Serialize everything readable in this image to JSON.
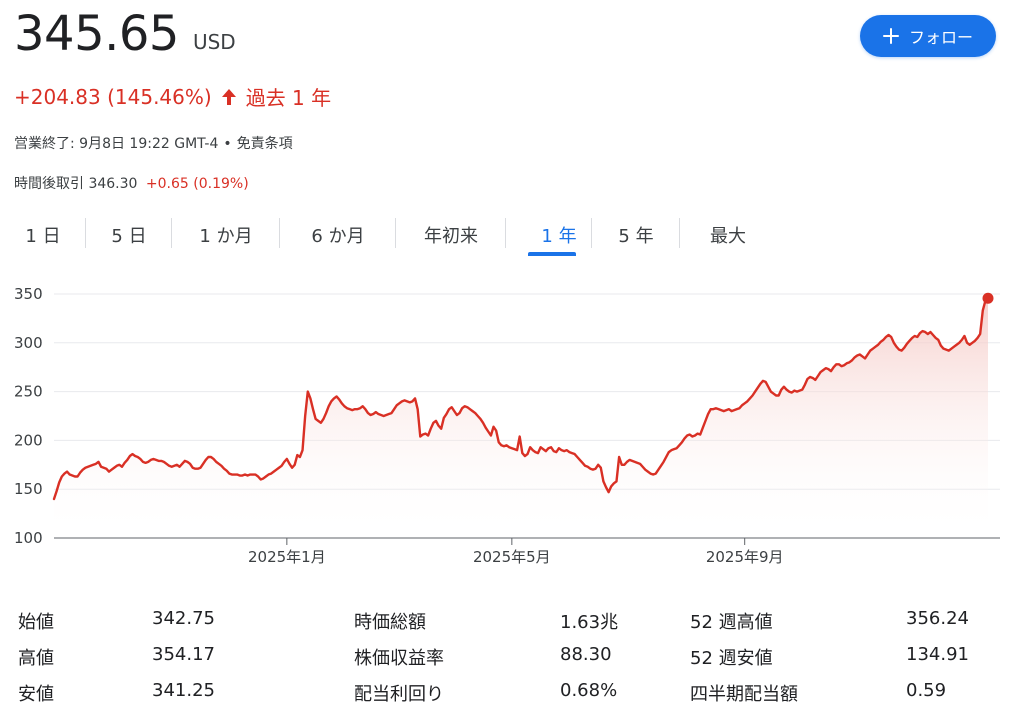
{
  "quote": {
    "price": "345.65",
    "currency": "USD",
    "change": "+204.83 (145.46%)",
    "period": "過去 1 年",
    "market_status": "営業終了: 9月8日 19:22 GMT-4",
    "separator": "•",
    "disclaimer": "免責条項",
    "after_hours_label": "時間後取引",
    "after_hours_price": "346.30",
    "after_hours_change": "+0.65 (0.19%)"
  },
  "follow_button": {
    "label": "フォロー"
  },
  "range_tabs": [
    {
      "label": "1 日",
      "active": false
    },
    {
      "label": "5 日",
      "active": false
    },
    {
      "label": "1 か月",
      "active": false
    },
    {
      "label": "6 か月",
      "active": false
    },
    {
      "label": "年初来",
      "active": false
    },
    {
      "label": "1 年",
      "active": true
    },
    {
      "label": "5 年",
      "active": false
    },
    {
      "label": "最大",
      "active": false
    }
  ],
  "colors": {
    "line": "#d93025",
    "accent": "#1a73e8",
    "grid": "#e8eaed",
    "fill_top": "#f4c7c3"
  },
  "chart_data": {
    "type": "area",
    "ylim": [
      100,
      350
    ],
    "yticks": [
      100,
      150,
      200,
      250,
      300,
      350
    ],
    "x_ticks": [
      {
        "label": "2025年1月",
        "index": 89
      },
      {
        "label": "2025年5月",
        "index": 175
      },
      {
        "label": "2025年9月",
        "index": 264
      }
    ],
    "values": [
      140,
      148,
      157,
      163,
      166,
      168,
      165,
      164,
      163,
      163,
      167,
      170,
      172,
      173,
      174,
      175,
      176,
      178,
      173,
      172,
      171,
      168,
      170,
      172,
      174,
      175,
      173,
      177,
      180,
      184,
      186,
      184,
      183,
      181,
      178,
      177,
      178,
      180,
      181,
      180,
      179,
      179,
      178,
      176,
      174,
      173,
      174,
      175,
      173,
      176,
      179,
      178,
      176,
      172,
      171,
      171,
      172,
      176,
      180,
      183,
      183,
      181,
      178,
      176,
      174,
      171,
      169,
      166,
      165,
      165,
      165,
      164,
      164,
      165,
      164,
      165,
      165,
      165,
      163,
      160,
      161,
      163,
      165,
      166,
      168,
      170,
      172,
      174,
      178,
      181,
      176,
      172,
      175,
      185,
      183,
      190,
      225,
      250,
      243,
      232,
      222,
      220,
      218,
      222,
      228,
      235,
      240,
      243,
      245,
      242,
      238,
      235,
      233,
      232,
      231,
      232,
      232,
      233,
      235,
      232,
      228,
      226,
      227,
      229,
      227,
      226,
      225,
      226,
      227,
      228,
      232,
      236,
      238,
      240,
      241,
      240,
      239,
      240,
      243,
      232,
      204,
      206,
      207,
      205,
      212,
      218,
      220,
      215,
      212,
      223,
      227,
      232,
      234,
      230,
      226,
      228,
      233,
      235,
      234,
      232,
      230,
      228,
      225,
      222,
      218,
      213,
      209,
      205,
      214,
      210,
      198,
      195,
      194,
      195,
      193,
      192,
      191,
      190,
      204,
      187,
      184,
      186,
      193,
      190,
      188,
      187,
      193,
      191,
      189,
      192,
      193,
      189,
      188,
      192,
      190,
      189,
      190,
      188,
      187,
      186,
      183,
      180,
      177,
      174,
      173,
      171,
      170,
      171,
      175,
      172,
      158,
      152,
      147,
      153,
      156,
      158,
      183,
      175,
      175,
      178,
      180,
      179,
      178,
      177,
      176,
      173,
      170,
      168,
      166,
      165,
      166,
      170,
      174,
      178,
      183,
      188,
      190,
      191,
      192,
      195,
      198,
      202,
      205,
      206,
      204,
      205,
      207,
      206,
      213,
      220,
      227,
      232,
      232,
      233,
      232,
      231,
      230,
      231,
      232,
      230,
      231,
      232,
      233,
      236,
      238,
      240,
      243,
      246,
      250,
      254,
      258,
      261,
      260,
      255,
      250,
      248,
      246,
      246,
      252,
      255,
      252,
      250,
      249,
      251,
      250,
      251,
      252,
      257,
      263,
      265,
      264,
      262,
      266,
      270,
      272,
      274,
      273,
      271,
      275,
      278,
      278,
      276,
      277,
      279,
      280,
      282,
      285,
      287,
      288,
      286,
      284,
      288,
      292,
      294,
      296,
      298,
      301,
      303,
      306,
      308,
      306,
      300,
      296,
      293,
      292,
      295,
      299,
      302,
      305,
      307,
      306,
      310,
      312,
      311,
      309,
      311,
      308,
      305,
      303,
      297,
      294,
      293,
      292,
      294,
      296,
      298,
      300,
      303,
      307,
      300,
      298,
      300,
      302,
      305,
      309,
      333,
      343,
      345.65
    ]
  },
  "stats": [
    [
      {
        "label": "始値",
        "value": "342.75"
      },
      {
        "label": "時価総額",
        "value": "1.63兆"
      },
      {
        "label": "52 週高値",
        "value": "356.24"
      }
    ],
    [
      {
        "label": "高値",
        "value": "354.17"
      },
      {
        "label": "株価収益率",
        "value": "88.30"
      },
      {
        "label": "52 週安値",
        "value": "134.91"
      }
    ],
    [
      {
        "label": "安値",
        "value": "341.25"
      },
      {
        "label": "配当利回り",
        "value": "0.68%"
      },
      {
        "label": "四半期配当額",
        "value": "0.59"
      }
    ]
  ]
}
